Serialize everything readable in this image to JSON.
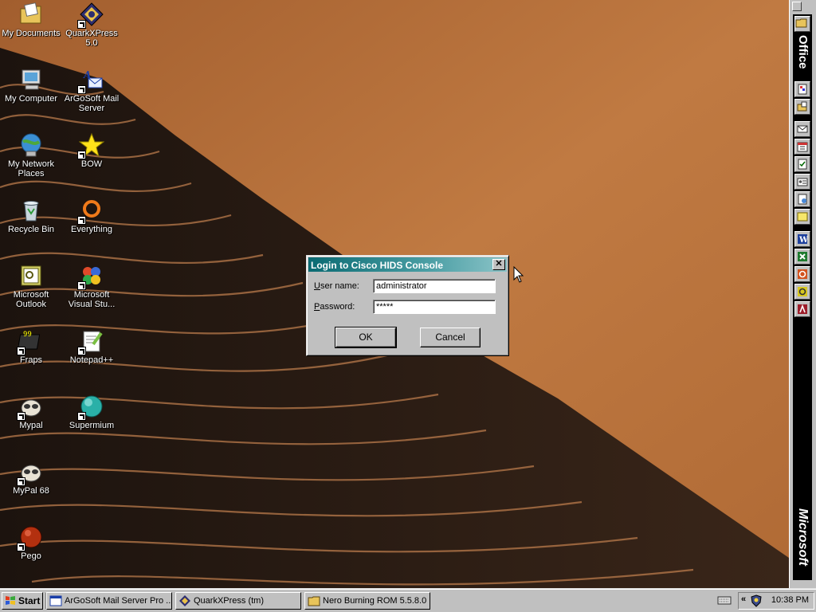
{
  "desktop": {
    "icons": [
      {
        "label": "My Documents",
        "icon": "my-documents-icon"
      },
      {
        "label": "My Computer",
        "icon": "my-computer-icon"
      },
      {
        "label": "My Network Places",
        "line2": "Places",
        "line1": "My Network",
        "icon": "network-places-icon"
      },
      {
        "label": "Recycle Bin",
        "icon": "recycle-bin-icon"
      },
      {
        "label": "Microsoft Outlook",
        "line1": "Microsoft",
        "line2": "Outlook",
        "icon": "outlook-icon"
      },
      {
        "label": "Fraps",
        "icon": "fraps-icon"
      },
      {
        "label": "Mypal",
        "icon": "mypal-icon"
      },
      {
        "label": "MyPal 68",
        "icon": "mypal-68-icon"
      },
      {
        "label": "Pego",
        "icon": "pego-icon"
      },
      {
        "label": "QuarkXPress 5.0",
        "line1": "QuarkXPress",
        "line2": "5.0",
        "icon": "quarkxpress-icon"
      },
      {
        "label": "ArGoSoft Mail Server",
        "line1": "ArGoSoft Mail",
        "line2": "Server",
        "icon": "argosoft-icon"
      },
      {
        "label": "BOW",
        "icon": "bow-star-icon"
      },
      {
        "label": "Everything",
        "icon": "everything-icon"
      },
      {
        "label": "Microsoft Visual Stu...",
        "line1": "Microsoft",
        "line2": "Visual Stu...",
        "icon": "visual-studio-icon"
      },
      {
        "label": "Notepad++",
        "icon": "notepad-plus-plus-icon"
      },
      {
        "label": "Supermium",
        "icon": "supermium-icon"
      }
    ]
  },
  "office_bar": {
    "label": "Office",
    "brand": "Microsoft"
  },
  "dialog": {
    "title": "Login to Cisco HIDS Console",
    "close": "✕",
    "username_label_u": "U",
    "username_label_rest": "ser name:",
    "username_value": "administrator",
    "password_label_u": "P",
    "password_label_rest": "assword:",
    "password_value": "*****",
    "ok_label": "OK",
    "cancel_label": "Cancel"
  },
  "taskbar": {
    "start_label": "Start",
    "tasks": [
      {
        "label": "ArGoSoft Mail Server Pro ..."
      },
      {
        "label": "QuarkXPress (tm)"
      },
      {
        "label": "Nero Burning ROM 5.5.8.0"
      }
    ],
    "tray_chevron": "«",
    "clock": "10:38 PM"
  },
  "colors": {
    "titlebar": "#0a6a72",
    "desktop_sand": "#b66f3a"
  }
}
